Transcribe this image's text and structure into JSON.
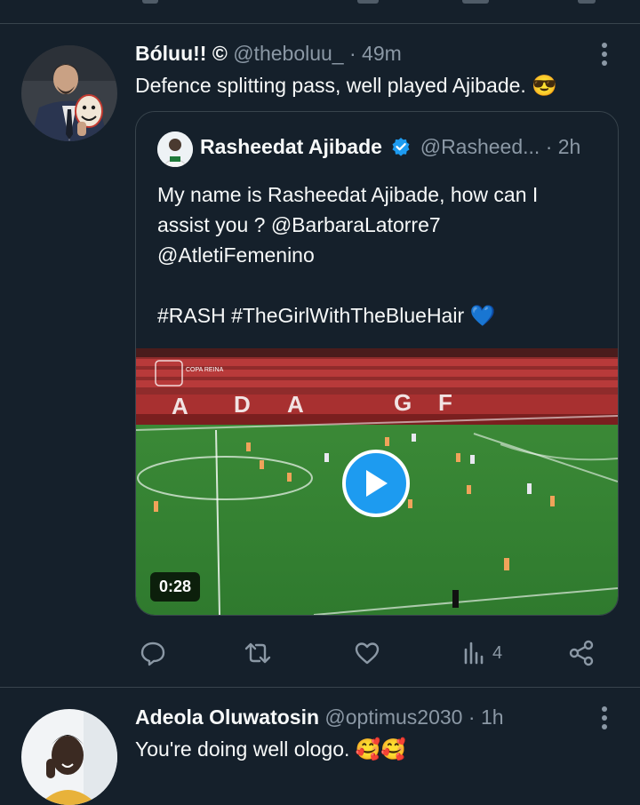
{
  "tweet1": {
    "name": "Bóluu!! ©",
    "handle": "@theboluu_",
    "separator": "·",
    "time": "49m",
    "text": "Defence splitting pass, well played Ajibade.",
    "emoji": "😎"
  },
  "quote": {
    "name": "Rasheedat Ajibade",
    "handle": "@Rasheed...",
    "separator": "·",
    "time": "2h",
    "text_line1": "My name is Rasheedat Ajibade, how can I",
    "text_line2": "assist you ? @BarbaraLatorre7",
    "text_line3": "@AtletiFemenino",
    "text_line4": "#RASH #TheGirlWithTheBlueHair 💙",
    "video": {
      "duration": "0:28",
      "stadium_letters": [
        "A",
        "D",
        "A",
        "G",
        "F"
      ],
      "overlay_logo_text": "COPA REINA"
    }
  },
  "actions": {
    "views_count": "4"
  },
  "tweet2": {
    "name": "Adeola Oluwatosin",
    "handle": "@optimus2030",
    "separator": "·",
    "time": "1h",
    "text": "You're doing well ologo.",
    "emoji": "🥰🥰"
  },
  "colors": {
    "background": "#15202b",
    "secondary_text": "#8b98a5",
    "accent": "#1d9bf0",
    "border": "#38444d"
  }
}
